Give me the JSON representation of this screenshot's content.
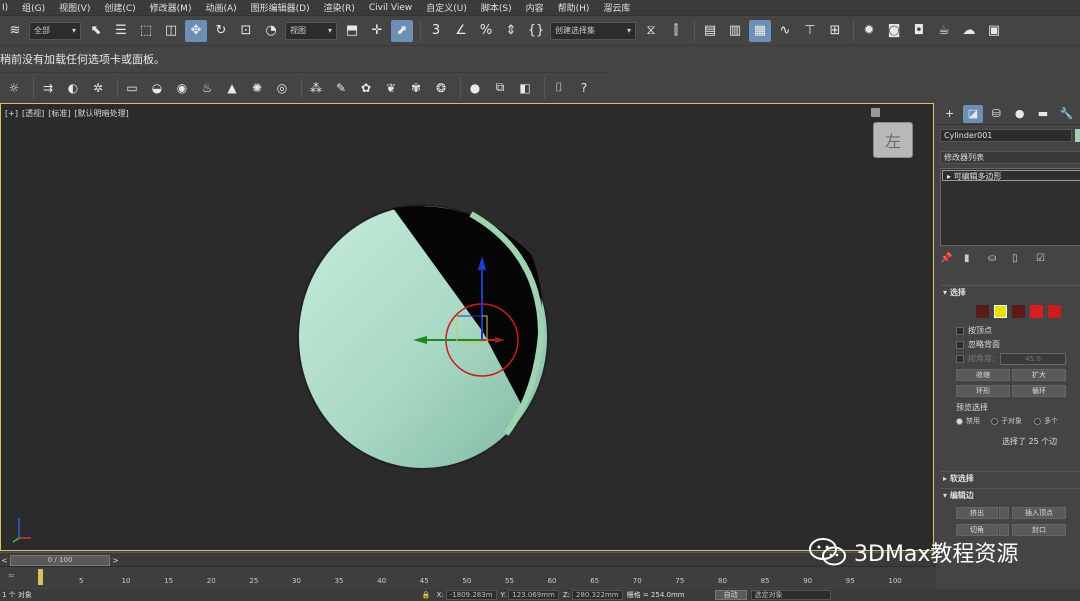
{
  "menubar": {
    "items": [
      "I)",
      "组(G)",
      "视图(V)",
      "创建(C)",
      "修改器(M)",
      "动画(A)",
      "图形编辑器(D)",
      "渲染(R)",
      "Civil View",
      "自定义(U)",
      "脚本(S)",
      "内容",
      "帮助(H)",
      "溜云库"
    ]
  },
  "toolbar": {
    "selection_filter": "全部",
    "ref_coord": "视图",
    "named_selection": "创建选择集"
  },
  "message": "稍前没有加载任何选项卡或面板。",
  "viewport": {
    "label_plus": "[+]",
    "label_view": "[透视]",
    "label_shading": "[标准]",
    "label_lighting": "[默认明暗处理]",
    "viewcube_face": "左"
  },
  "command_panel": {
    "object_name": "Cylinder001",
    "object_color": "#9fd4b3",
    "modifier_list": "修改器列表",
    "stack_item": "可编辑多边形",
    "rollout_selection": "选择",
    "by_vertex": "按顶点",
    "ignore_backfacing": "忽略背面",
    "by_angle": "按角度:",
    "angle_value": "45.0",
    "shrink": "收缩",
    "grow": "扩大",
    "ring": "环形",
    "loop": "循环",
    "preview_selection": "预览选择",
    "preview_disabled": "禁用",
    "preview_subobject": "子对象",
    "preview_multi": "多个",
    "selection_status": "选择了 25 个边",
    "rollout_soft": "软选择",
    "rollout_edit_edges": "编辑边",
    "extrude": "挤出",
    "insert_vertex": "插入顶点",
    "chamfer": "切角",
    "cap": "封口"
  },
  "timeline": {
    "frame_display": "0 / 100",
    "ticks": [
      "5",
      "10",
      "15",
      "20",
      "25",
      "30",
      "35",
      "40",
      "45",
      "50",
      "55",
      "60",
      "65",
      "70",
      "75",
      "80",
      "85",
      "90",
      "95",
      "100"
    ]
  },
  "statusbar": {
    "objects": "1 个 对象",
    "x_label": "X:",
    "x_value": "-1809.283m",
    "y_label": "Y:",
    "y_value": "123.069mm",
    "z_label": "Z:",
    "z_value": "280.322mm",
    "grid": "栅格 = 254.0mm",
    "auto_key": "自动",
    "set_key": "选定对象"
  },
  "watermark": "3DMax教程资源"
}
